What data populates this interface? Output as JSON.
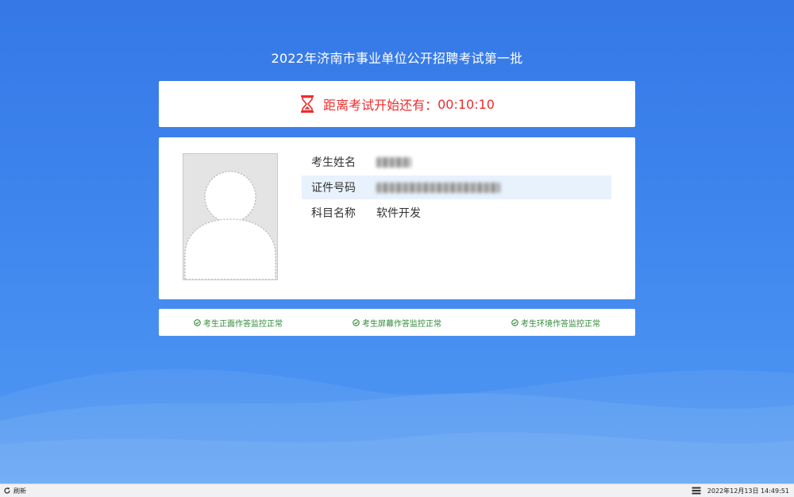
{
  "exam": {
    "title": "2022年济南市事业单位公开招聘考试第一批"
  },
  "countdown": {
    "label": "距离考试开始还有：",
    "time": "00:10:10",
    "color": "#ee2c2c"
  },
  "candidate": {
    "name_label": "考生姓名",
    "id_label": "证件号码",
    "subject_label": "科目名称",
    "subject_value": "软件开发"
  },
  "monitor": {
    "items": [
      {
        "label": "考生正面作答监控正常"
      },
      {
        "label": "考生屏幕作答监控正常"
      },
      {
        "label": "考生环境作答监控正常"
      }
    ],
    "color": "#2f8a35"
  },
  "taskbar": {
    "refresh_label": "刷新",
    "datetime": "2022年12月13日 14:49:51"
  },
  "icons": {
    "timer": "hourglass-icon",
    "status": "check-circle-icon",
    "refresh": "refresh-icon",
    "keyboard": "keyboard-icon"
  }
}
